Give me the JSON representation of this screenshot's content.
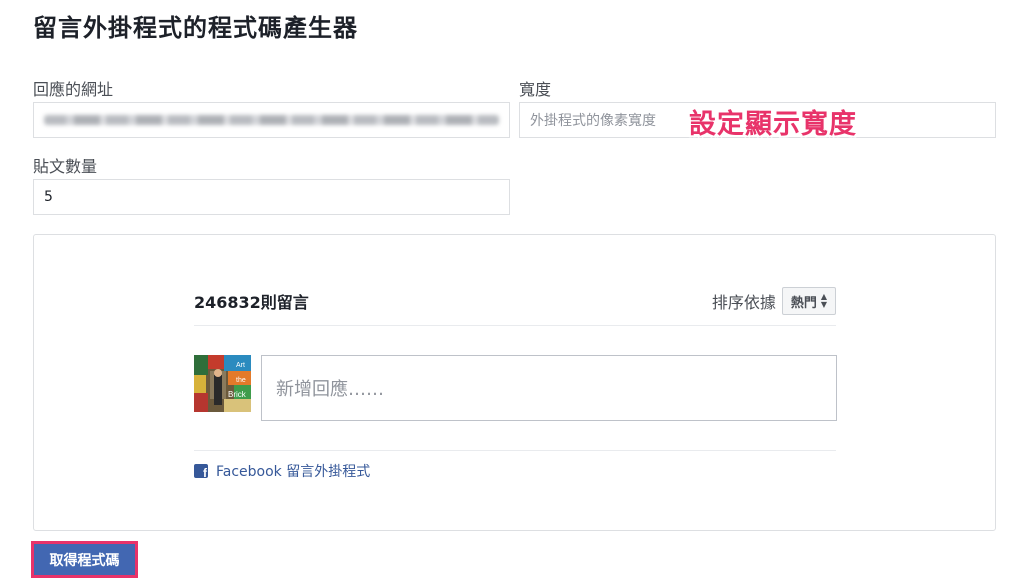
{
  "title": "留言外掛程式的程式碼產生器",
  "form": {
    "url_label": "回應的網址",
    "width_label": "寬度",
    "width_placeholder": "外掛程式的像素寬度",
    "count_label": "貼文數量",
    "count_value": "5"
  },
  "annotation": "設定顯示寬度",
  "preview": {
    "comment_count": "246832則留言",
    "sort_label": "排序依據",
    "sort_value": "熱門",
    "comment_placeholder": "新增回應……",
    "plugin_link": "Facebook 留言外掛程式",
    "avatar_words": [
      "Art",
      "the",
      "Brick"
    ]
  },
  "button": {
    "label": "取得程式碼"
  },
  "colors": {
    "accent": "#e8336a",
    "button": "#4267b2",
    "link": "#365899"
  }
}
